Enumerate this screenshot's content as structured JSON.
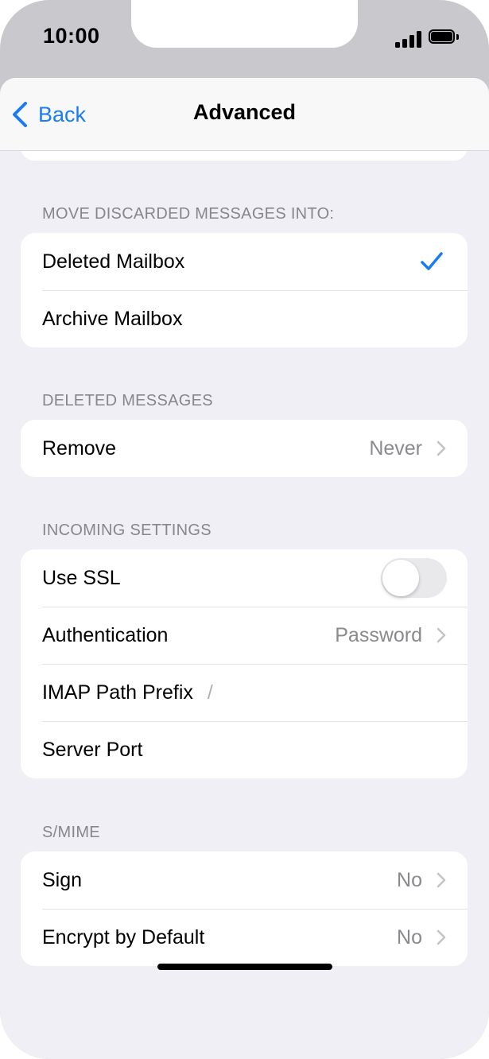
{
  "status_bar": {
    "time": "10:00"
  },
  "nav": {
    "back_label": "Back",
    "title": "Advanced"
  },
  "sections": {
    "discard": {
      "header": "MOVE DISCARDED MESSAGES INTO:",
      "rows": [
        {
          "label": "Deleted Mailbox",
          "selected": true
        },
        {
          "label": "Archive Mailbox",
          "selected": false
        }
      ]
    },
    "deleted": {
      "header": "DELETED MESSAGES",
      "remove_label": "Remove",
      "remove_value": "Never"
    },
    "incoming": {
      "header": "INCOMING SETTINGS",
      "ssl_label": "Use SSL",
      "ssl_enabled": false,
      "auth_label": "Authentication",
      "auth_value": "Password",
      "imap_label": "IMAP Path Prefix",
      "imap_value": "/",
      "port_label": "Server Port",
      "port_value": ""
    },
    "smime": {
      "header": "S/MIME",
      "sign_label": "Sign",
      "sign_value": "No",
      "encrypt_label": "Encrypt by Default",
      "encrypt_value": "No"
    }
  },
  "colors": {
    "accent": "#1a7cf5",
    "background": "#f0eff5",
    "secondary_text": "#8a8a8e",
    "toggle_off": "#e9e9eb"
  },
  "icons": {
    "back": "chevron-left-icon",
    "selected": "checkmark-icon",
    "disclosure": "chevron-right-icon",
    "signal": "cellular-signal-icon",
    "battery": "battery-icon"
  }
}
